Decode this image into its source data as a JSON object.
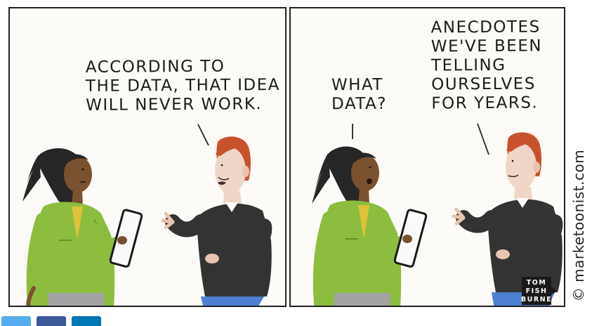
{
  "panels": [
    {
      "speech": "ACCORDING TO\nTHE DATA, THAT IDEA\nWILL NEVER WORK."
    },
    {
      "speech_left": "WHAT\nDATA?",
      "speech_right": "ANECDOTES\nWE'VE BEEN\nTELLING\nOURSELVES\nFOR YEARS."
    }
  ],
  "credit": "© marketoonist.com",
  "artist": [
    "TOM",
    "FISH",
    "BURNE"
  ],
  "share_buttons": [
    "twitter-icon",
    "facebook-icon",
    "linkedin-icon"
  ],
  "colors": {
    "panel_background": "#fdfbf7",
    "woman_jacket": "#8cbd3f",
    "man_sweater": "#333333",
    "man_pants": "#4d7fd1",
    "man_hair": "#c8522d",
    "share_twitter": "#55acee",
    "share_facebook": "#3b5998",
    "share_linkedin": "#0077b5"
  }
}
